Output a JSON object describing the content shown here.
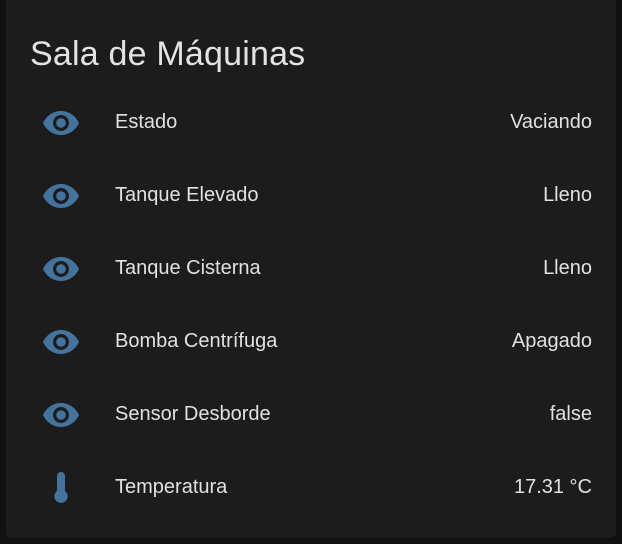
{
  "card": {
    "title": "Sala de Máquinas",
    "icon_color": "#44739e"
  },
  "entities": [
    {
      "icon": "eye-icon",
      "label": "Estado",
      "value": "Vaciando"
    },
    {
      "icon": "eye-icon",
      "label": "Tanque Elevado",
      "value": "Lleno"
    },
    {
      "icon": "eye-icon",
      "label": "Tanque Cisterna",
      "value": "Lleno"
    },
    {
      "icon": "eye-icon",
      "label": "Bomba Centrífuga",
      "value": "Apagado"
    },
    {
      "icon": "eye-icon",
      "label": "Sensor Desborde",
      "value": "false"
    },
    {
      "icon": "thermometer-icon",
      "label": "Temperatura",
      "value": "17.31 °C"
    }
  ]
}
